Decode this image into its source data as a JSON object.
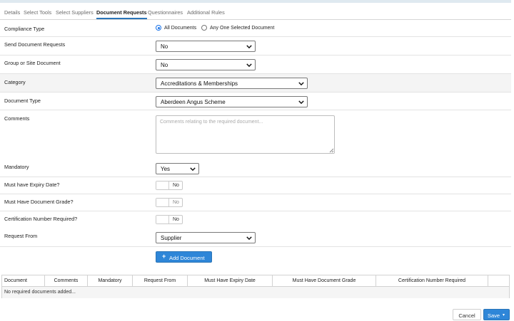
{
  "tabs": [
    "Details",
    "Select Tools",
    "Select Suppliers",
    "Document Requests",
    "Questionnaires",
    "Additional Rules"
  ],
  "active_tab": "Document Requests",
  "form": {
    "compliance_type": {
      "label": "Compliance Type",
      "options": [
        "All Documents",
        "Any One Selected Document"
      ],
      "selected": "All Documents"
    },
    "send_document_requests": {
      "label": "Send Document Requests",
      "value": "No"
    },
    "group_or_site_document": {
      "label": "Group or Site Document",
      "value": "No"
    },
    "category": {
      "label": "Category",
      "value": "Accreditations & Memberships"
    },
    "document_type": {
      "label": "Document Type",
      "value": "Aberdeen Angus Scheme"
    },
    "comments": {
      "label": "Comments",
      "value": "",
      "placeholder": "Comments relating to the required document..."
    },
    "mandatory": {
      "label": "Mandatory",
      "value": "Yes"
    },
    "must_have_expiry_date": {
      "label": "Must have Expiry Date?",
      "value": "No"
    },
    "must_have_document_grade": {
      "label": "Must Have Document Grade?",
      "value": "No"
    },
    "certification_number_required": {
      "label": "Certification Number Required?",
      "value": "No"
    },
    "request_from": {
      "label": "Request From",
      "value": "Supplier"
    }
  },
  "add_document_label": "Add Document",
  "table": {
    "columns": [
      "Document",
      "Comments",
      "Mandatory",
      "Request From",
      "Must Have Expiry Date",
      "Must Have Document Grade",
      "Certification Number Required"
    ],
    "empty_message": "No required documents added..."
  },
  "footer": {
    "cancel_label": "Cancel",
    "save_label": "Save"
  },
  "colors": {
    "primary": "#2e86d8",
    "active_tab_underline": "#2b76b9",
    "radio_checked": "#1a73e8"
  }
}
